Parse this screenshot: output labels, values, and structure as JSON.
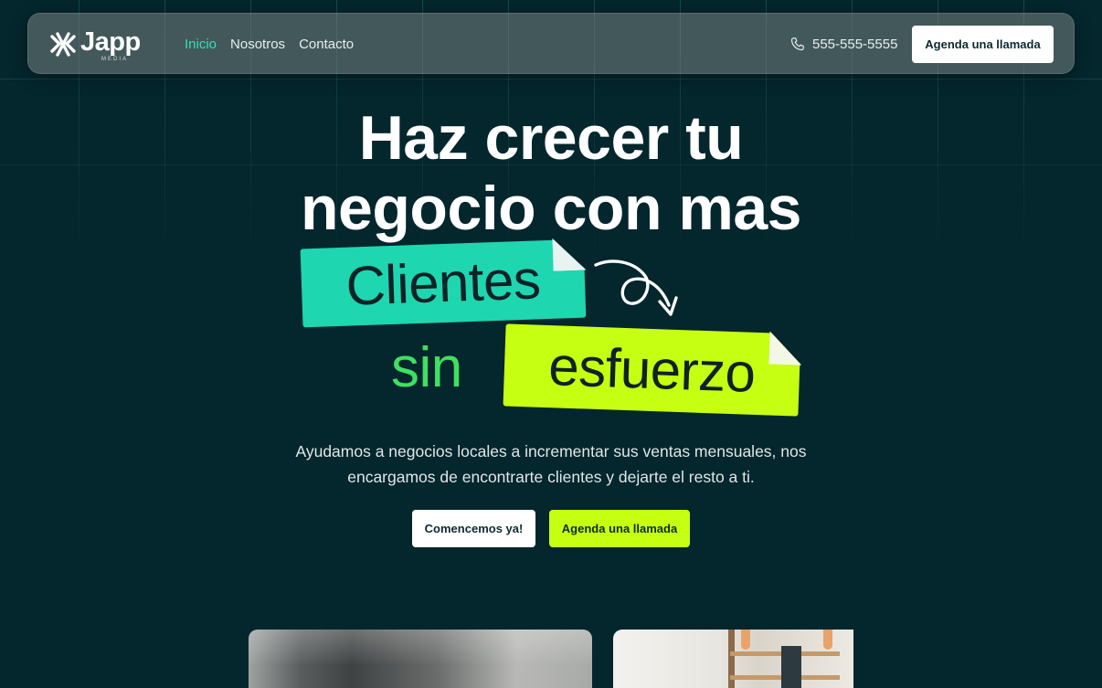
{
  "nav": {
    "logo_text": "Japp",
    "logo_subtext": "MEDIA",
    "links": [
      "Inicio",
      "Nosotros",
      "Contacto"
    ],
    "active_link": "Inicio",
    "phone": "555-555-5555",
    "cta_label": "Agenda una llamada"
  },
  "hero": {
    "line1": "Haz crecer tu",
    "line2": "negocio con mas",
    "tag1": "Clientes",
    "word_sin": "sin",
    "tag2": "esfuerzo",
    "subtitle_line1": "Ayudamos a negocios locales a incrementar sus ventas mensuales, nos",
    "subtitle_line2": "encargamos de encontrarte clientes y dejarte el resto a ti.",
    "primary_button": "Comencemos ya!",
    "secondary_button": "Agenda una llamada"
  },
  "colors": {
    "background": "#04262d",
    "accent_teal": "#1ed6b0",
    "accent_lime": "#c7ff12",
    "accent_green": "#3fe060",
    "nav_active": "#2ee0b4"
  },
  "icons": {
    "logo": "japp-logo-icon",
    "phone": "phone-icon",
    "arrow": "curly-arrow-icon"
  }
}
